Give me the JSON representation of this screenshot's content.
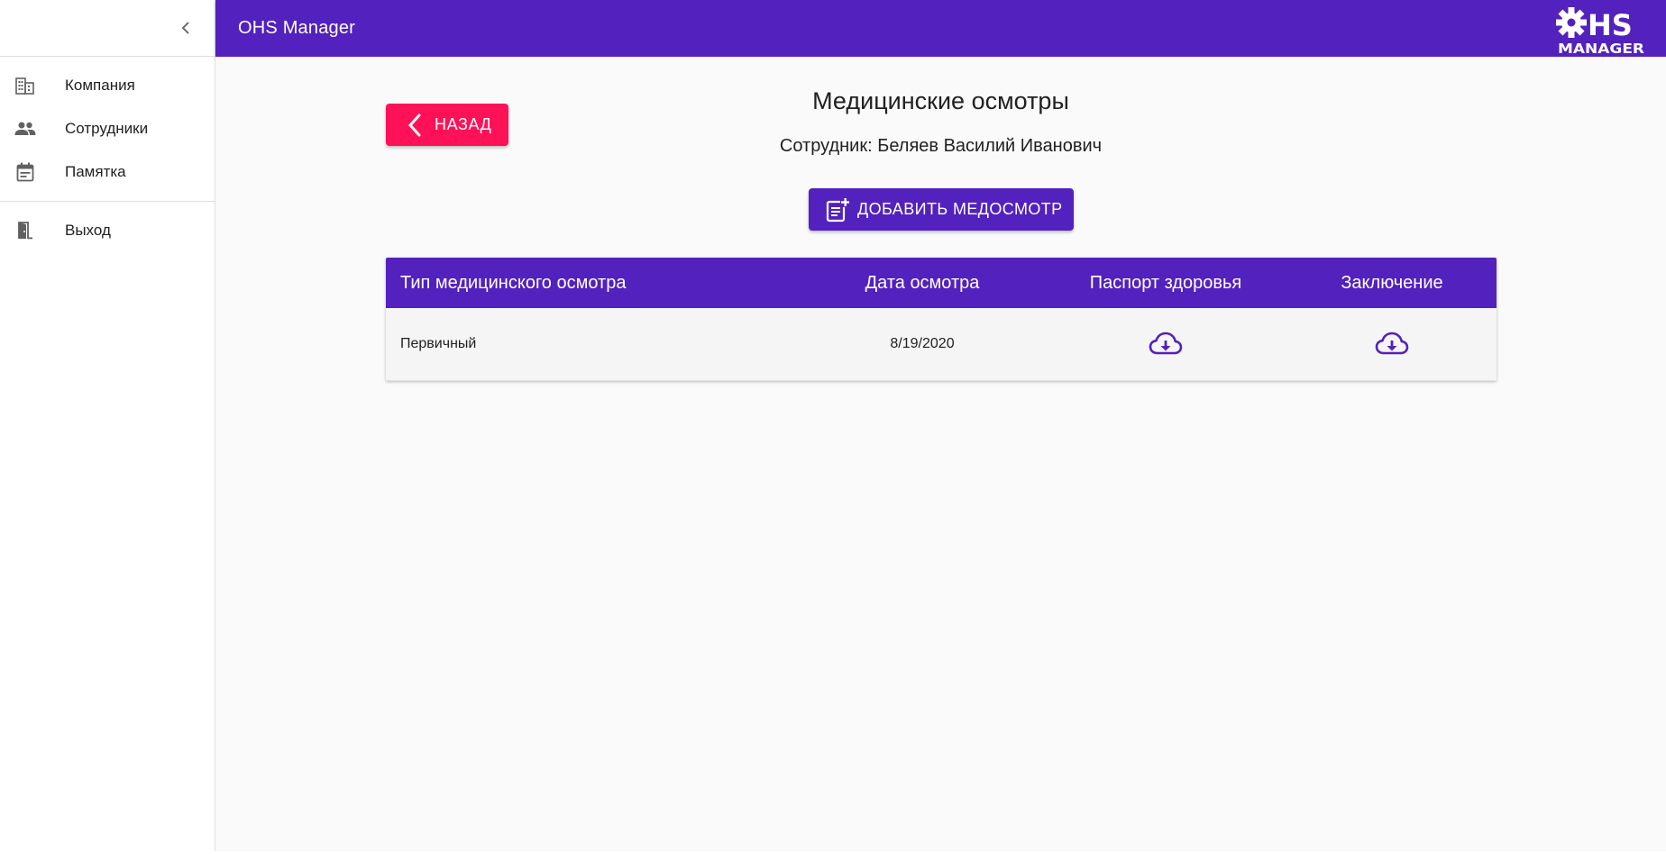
{
  "app": {
    "title": "OHS Manager",
    "logo_text_top": "HS",
    "logo_text_bottom": "MANAGER"
  },
  "sidebar": {
    "collapse_icon": "chevron-left-icon",
    "items": [
      {
        "label": "Компания",
        "icon": "building-icon"
      },
      {
        "label": "Сотрудники",
        "icon": "people-icon"
      },
      {
        "label": "Памятка",
        "icon": "calendar-icon"
      }
    ],
    "logout": {
      "label": "Выход",
      "icon": "door-exit-icon"
    }
  },
  "main": {
    "back_button": "НАЗАД",
    "title": "Медицинские осмотры",
    "subtitle": "Сотрудник: Беляев Василий Иванович",
    "add_button": "ДОБАВИТЬ МЕДОСМОТР",
    "table": {
      "headers": [
        "Тип медицинского осмотра",
        "Дата осмотра",
        "Паспорт здоровья",
        "Заключение"
      ],
      "rows": [
        {
          "type": "Первичный",
          "date": "8/19/2020",
          "passport_icon": "cloud-download-icon",
          "conclusion_icon": "cloud-download-icon"
        }
      ]
    }
  },
  "colors": {
    "primary": "#5321bd",
    "accent": "#ff1157",
    "background": "#fafafa"
  }
}
